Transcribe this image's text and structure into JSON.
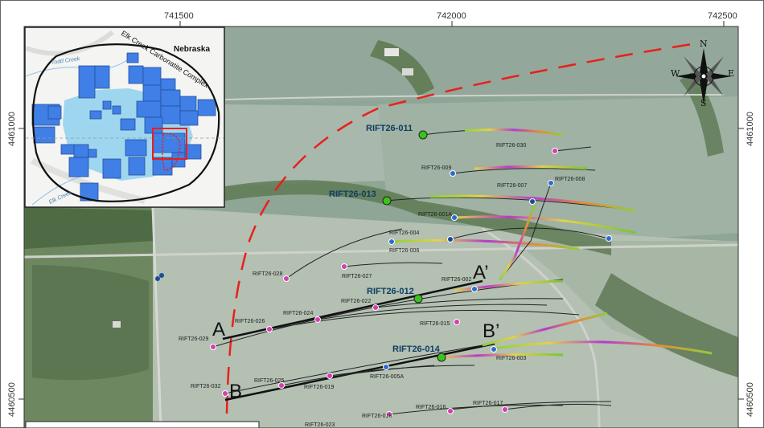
{
  "map": {
    "coords_top": [
      "741500",
      "742000",
      "742500"
    ],
    "coords_left": [
      "4461000",
      "4460500"
    ],
    "coords_right": [
      "4461000",
      "4460500"
    ],
    "compass": {
      "n": "N",
      "s": "S",
      "e": "E",
      "w": "W"
    },
    "section_labels": {
      "a": "A",
      "a_prime": "A’",
      "b": "B",
      "b_prime": "B’"
    },
    "drillholes": {
      "h011": "RIFT26-011",
      "h013": "RIFT26-013",
      "h012": "RIFT26-012",
      "h014": "RIFT26-014",
      "h030": "RIFT26-030",
      "h009": "RIFT26-009",
      "h007": "RIFT26-007",
      "h008": "RIFT26-008",
      "h001a": "RIFT26-001A",
      "h004": "RIFT26-004",
      "h006": "RIFT26-006",
      "h028": "RIFT26-028",
      "h027": "RIFT26-027",
      "h002": "RIFT26-002",
      "h022": "RIFT26-022",
      "h024": "RIFT26-024",
      "h026": "RIFT26-026",
      "h029": "RIFT26-029",
      "h015": "RIFT26-015",
      "h003": "RIFT26-003",
      "h005a": "RIFT26-005A",
      "h025": "RIFT26-025",
      "h019": "RIFT26-019",
      "h032": "RIFT26-032",
      "h018": "RIFT26-018",
      "h016": "RIFT26-016",
      "h017": "RIFT26-017",
      "h023": "RIFT26-023"
    },
    "inset": {
      "complex_label": "Elk Creek Carbonatite Complex",
      "state_label": "Nebraska",
      "creek_label_1": "Todd Creek",
      "creek_label_2": "Elk Creek"
    },
    "colors": {
      "fault": "#e8201c",
      "collar_highlight": "#39c41a",
      "collar_pink": "#d43fae",
      "collar_blue": "#2d6bd0",
      "claim_blue": "#3f7fe6",
      "claim_light": "#9fd6ef"
    }
  }
}
